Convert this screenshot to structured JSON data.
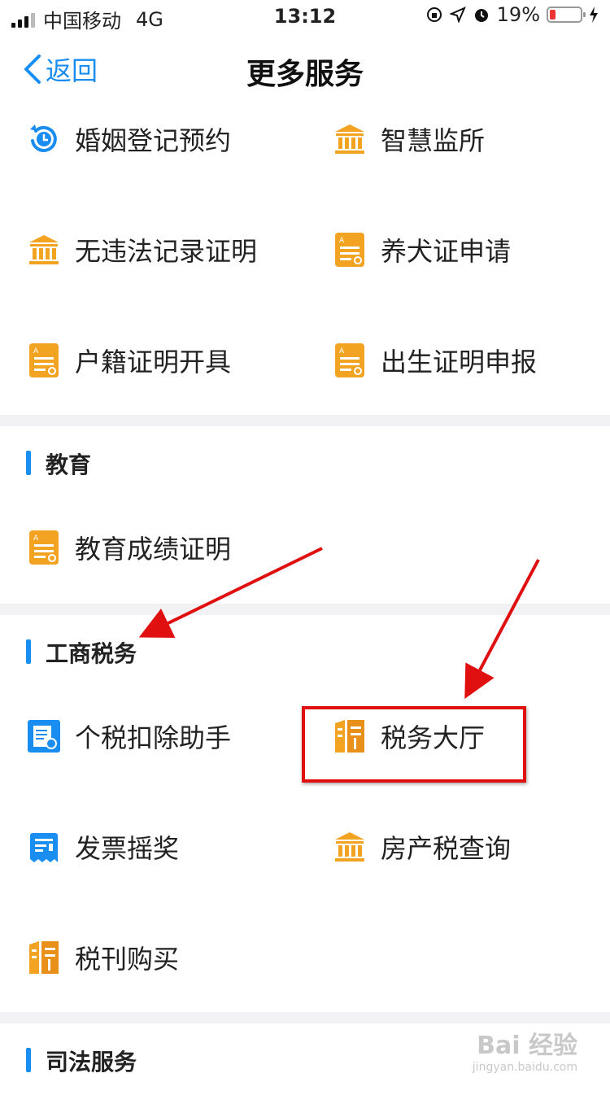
{
  "status_bar": {
    "carrier": "中国移动",
    "network": "4G",
    "time": "13:12",
    "battery": "19%",
    "battery_level": 0.19
  },
  "nav": {
    "back_label": "返回",
    "title": "更多服务"
  },
  "section_top": {
    "items": [
      {
        "label": "婚姻登记预约",
        "icon": "clock-icon"
      },
      {
        "label": "智慧监所",
        "icon": "bank-icon"
      },
      {
        "label": "无违法记录证明",
        "icon": "bank-icon"
      },
      {
        "label": "养犬证申请",
        "icon": "certificate-icon"
      },
      {
        "label": "户籍证明开具",
        "icon": "certificate-icon"
      },
      {
        "label": "出生证明申报",
        "icon": "certificate-icon"
      }
    ]
  },
  "section_education": {
    "title": "教育",
    "items": [
      {
        "label": "教育成绩证明",
        "icon": "certificate-icon"
      }
    ]
  },
  "section_tax": {
    "title": "工商税务",
    "items": [
      {
        "label": "个税扣除助手",
        "icon": "tax-doc-icon"
      },
      {
        "label": "税务大厅",
        "icon": "tax-logo-icon"
      },
      {
        "label": "发票摇奖",
        "icon": "invoice-icon"
      },
      {
        "label": "房产税查询",
        "icon": "bank-icon"
      },
      {
        "label": "税刊购买",
        "icon": "tax-logo-icon"
      }
    ]
  },
  "section_judicial": {
    "title": "司法服务"
  },
  "watermark": {
    "brand": "Bai 经验",
    "url": "jingyan.baidu.com"
  },
  "colors": {
    "accent": "#1a8ef0",
    "icon_orange": "#f2a322",
    "highlight_red": "#e01010"
  }
}
